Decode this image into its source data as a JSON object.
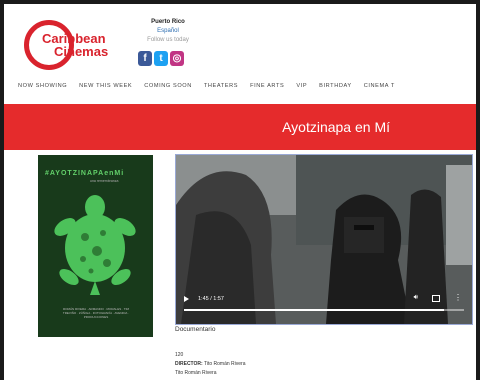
{
  "header": {
    "logo": {
      "line1": "Caribbean",
      "line2": "Cinemas"
    },
    "region": "Puerto Rico",
    "language_link": "Español",
    "follow_text": "Follow us today",
    "social": [
      {
        "name": "facebook-icon",
        "glyph": "f"
      },
      {
        "name": "twitter-icon",
        "glyph": "t"
      },
      {
        "name": "instagram-icon",
        "glyph": "◎"
      }
    ]
  },
  "nav": {
    "items": [
      "NOW SHOWING",
      "NEW THIS WEEK",
      "COMING SOON",
      "THEATERS",
      "FINE ARTS",
      "VIP",
      "BIRTHDAY",
      "CINEMA T"
    ]
  },
  "banner": {
    "title": "Ayotzinapa en Mí",
    "color": "#e52b2c"
  },
  "poster": {
    "title": "#AYOTZINAPAenMi",
    "subtitle": "una remembranza",
    "credits": "ROMÁN RIVERA · ARMANDO · MORALES · TIM TREVIÑO · ZÚÑIGA · FOTOGRAFÍA · AVENIDA · PRODUCCIONES"
  },
  "video": {
    "time": "1:45 / 1:57",
    "progress": 0.93
  },
  "details": {
    "genre": "Documentario",
    "runtime": "120",
    "director_label": "DIRECTOR:",
    "director": "Tito Román Rivera",
    "cast": "Tito Román Rivera"
  }
}
